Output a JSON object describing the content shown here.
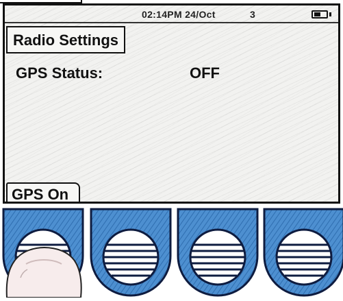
{
  "status_bar": {
    "time_date": "02:14PM 24/Oct",
    "signal": "3",
    "battery_icon": "battery-icon"
  },
  "screen": {
    "title": "Radio Settings",
    "gps_status_label": "GPS Status:",
    "gps_status_value": "OFF"
  },
  "softkeys": {
    "key1_label": "GPS On"
  },
  "colors": {
    "key_blue": "#4d8fd0",
    "key_outline": "#0e1c40",
    "screen_bg": "#f2f2f0"
  }
}
